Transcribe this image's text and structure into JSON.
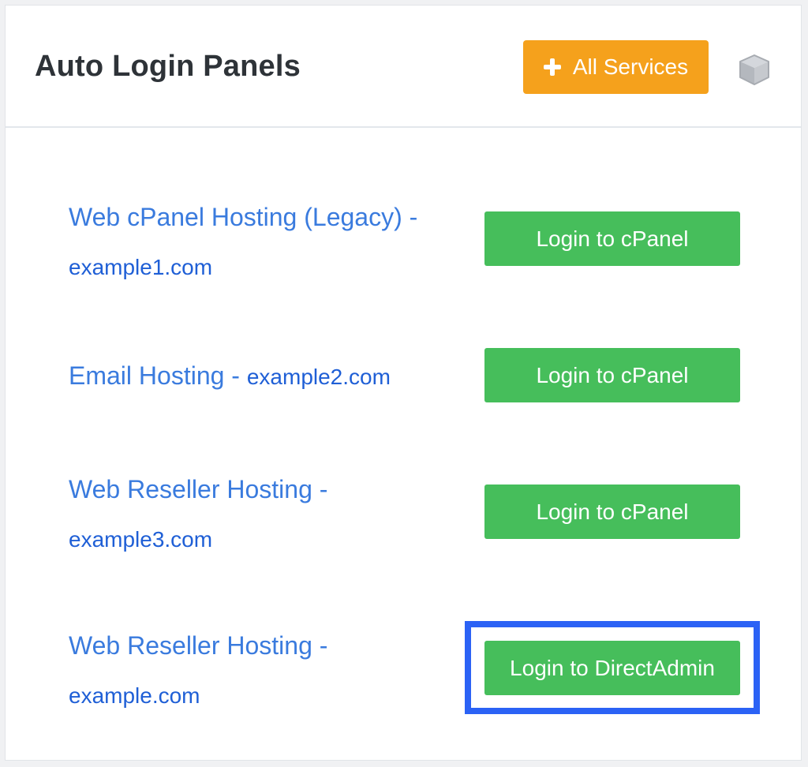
{
  "panel": {
    "title": "Auto Login Panels",
    "all_services_label": "All Services",
    "all_services_icon": "plus-icon",
    "header_icon": "cube-icon"
  },
  "colors": {
    "link": "#3a7bde",
    "domain": "#1f5fd6",
    "login_button": "#46be5b",
    "all_services_button": "#f5a11c",
    "highlight": "#2b62f5"
  },
  "services": [
    {
      "name": "Web cPanel Hosting (Legacy) - ",
      "domain": "example1.com",
      "button_label": "Login to cPanel"
    },
    {
      "name": "Email Hosting - ",
      "domain": "example2.com",
      "button_label": "Login to cPanel"
    },
    {
      "name": "Web Reseller Hosting - ",
      "domain": "example3.com",
      "button_label": "Login to cPanel"
    },
    {
      "name": "Web Reseller Hosting - ",
      "domain": "example.com",
      "button_label": "Login to DirectAdmin",
      "highlighted": true
    }
  ]
}
